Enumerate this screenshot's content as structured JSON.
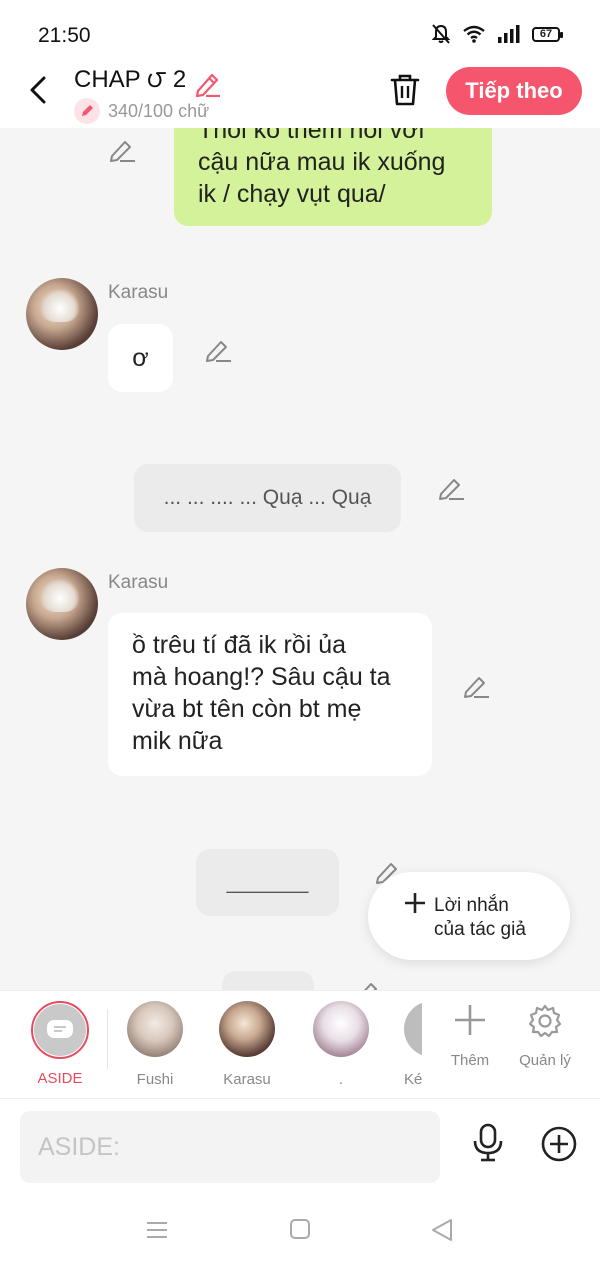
{
  "status": {
    "time": "21:50",
    "battery": "67"
  },
  "header": {
    "title": "CHAP ౮ 2",
    "word_count": "340/100 chữ",
    "next_label": "Tiếp theo",
    "accent": "#f5566e"
  },
  "messages": [
    {
      "type": "self",
      "text_lines": [
        "Thôi kô thèm nói với",
        "cậu nữa mau ik xuống",
        "ik / chạy vụt qua/"
      ]
    },
    {
      "type": "character",
      "sender": "Karasu",
      "text_lines": [
        "ơ"
      ]
    },
    {
      "type": "aside",
      "text": "... ... .... ... Quạ ... Quạ"
    },
    {
      "type": "character",
      "sender": "Karasu",
      "text_lines": [
        "ồ trêu tí đã ik rồi ủa",
        "mà hoang!? Sâu cậu ta",
        "vừa bt tên còn bt mẹ",
        "mik nữa"
      ]
    },
    {
      "type": "aside",
      "text": "_______"
    }
  ],
  "author_note": {
    "line1": "Lời nhắn",
    "line2": "của tác giả"
  },
  "characters": [
    {
      "name": "ASIDE",
      "selected": true
    },
    {
      "name": "Fushi"
    },
    {
      "name": "Karasu"
    },
    {
      "name": "."
    },
    {
      "name": "Ké"
    }
  ],
  "tools": {
    "add_label": "Thêm",
    "manage_label": "Quản lý"
  },
  "input": {
    "placeholder": "ASIDE:"
  }
}
